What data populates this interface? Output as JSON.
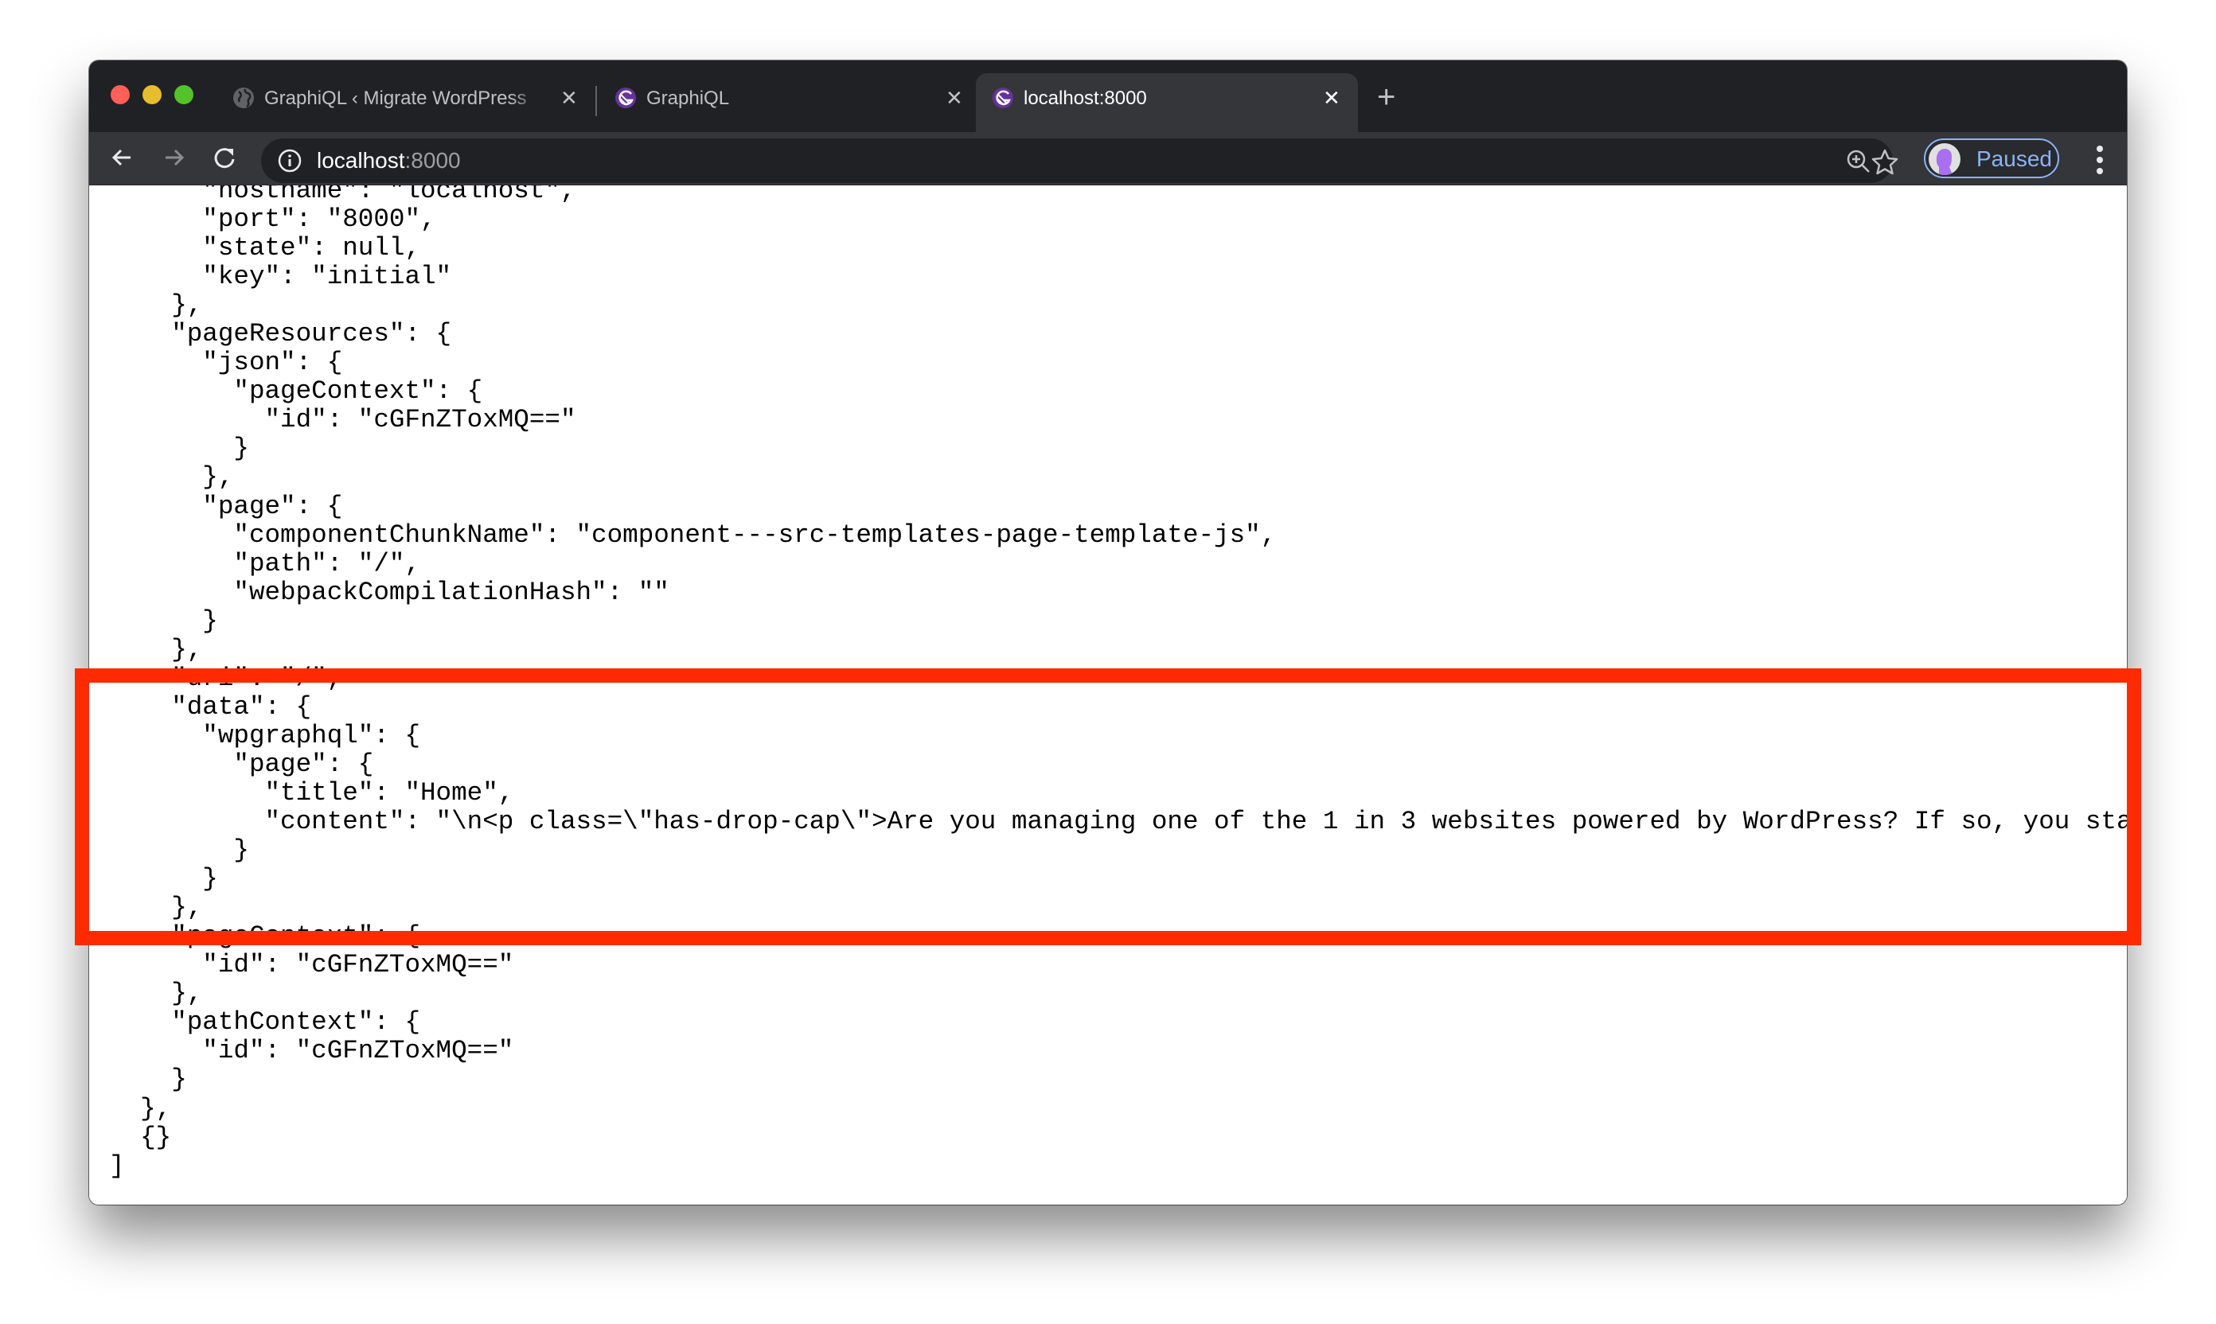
{
  "window": {
    "controls": [
      "close",
      "minimize",
      "zoom"
    ]
  },
  "tabs": [
    {
      "title": "GraphiQL ‹ Migrate WordPress",
      "favicon": "globe-icon",
      "active": false
    },
    {
      "title": "GraphiQL",
      "favicon": "gatsby-icon",
      "active": false
    },
    {
      "title": "localhost:8000",
      "favicon": "gatsby-icon",
      "active": true
    }
  ],
  "new_tab_label": "+",
  "close_glyph": "✕",
  "toolbar": {
    "url_host": "localhost",
    "url_port": ":8000",
    "profile_label": "Paused"
  },
  "colors": {
    "highlight": "#ff2a00",
    "profile_accent": "#8ab4f8",
    "gatsby_purple": "#663399"
  },
  "code_lines": [
    "      \"hostname\": \"localhost\",",
    "      \"port\": \"8000\",",
    "      \"state\": null,",
    "      \"key\": \"initial\"",
    "    },",
    "    \"pageResources\": {",
    "      \"json\": {",
    "        \"pageContext\": {",
    "          \"id\": \"cGFnZToxMQ==\"",
    "        }",
    "      },",
    "      \"page\": {",
    "        \"componentChunkName\": \"component---src-templates-page-template-js\",",
    "        \"path\": \"/\",",
    "        \"webpackCompilationHash\": \"\"",
    "      }",
    "    },",
    "    \"uri\": \"/\",",
    "    \"data\": {",
    "      \"wpgraphql\": {",
    "        \"page\": {",
    "          \"title\": \"Home\",",
    "          \"content\": \"\\n<p class=\\\"has-drop-cap\\\">Are you managing one of the 1 in 3 websites powered by WordPress? If so, you star",
    "        }",
    "      }",
    "    },",
    "    \"pageContext\": {",
    "      \"id\": \"cGFnZToxMQ==\"",
    "    },",
    "    \"pathContext\": {",
    "      \"id\": \"cGFnZToxMQ==\"",
    "    }",
    "  },",
    "  {}",
    "]"
  ]
}
